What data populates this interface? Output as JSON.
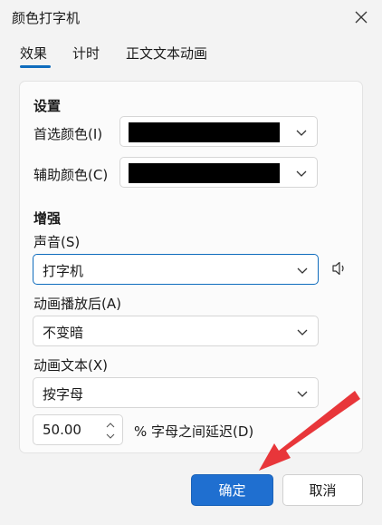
{
  "window": {
    "title": "颜色打字机"
  },
  "tabs": [
    {
      "label": "效果"
    },
    {
      "label": "计时"
    },
    {
      "label": "正文文本动画"
    }
  ],
  "settings": {
    "heading": "设置",
    "primary_color_label": "首选颜色(I)",
    "primary_color_value": "#000000",
    "secondary_color_label": "辅助颜色(C)",
    "secondary_color_value": "#000000"
  },
  "enhancements": {
    "heading": "增强",
    "sound_label": "声音(S)",
    "sound_value": "打字机",
    "after_animation_label": "动画播放后(A)",
    "after_animation_value": "不变暗",
    "animate_text_label": "动画文本(X)",
    "animate_text_value": "按字母",
    "delay_value": "50.00",
    "delay_suffix": "% 字母之间延迟(D)"
  },
  "buttons": {
    "ok": "确定",
    "cancel": "取消"
  },
  "colors": {
    "accent": "#1f6fd0",
    "annotation_arrow": "#e8363a"
  }
}
